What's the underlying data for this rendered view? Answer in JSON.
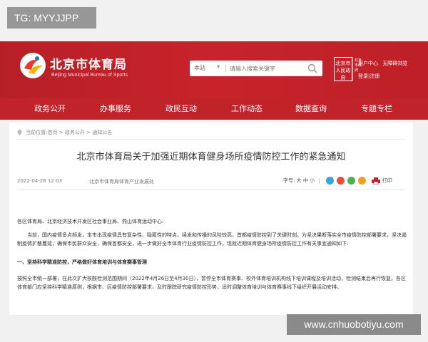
{
  "watermarks": {
    "top": "TG: MYYJJPP",
    "bottom": "www.cnhuobotiyu.com"
  },
  "header": {
    "site_title": "北京市体育局",
    "site_subtitle": "Beijing Municipal Bureau of Sports",
    "search": {
      "scope": "本站",
      "placeholder": "请输入搜索关键字"
    },
    "emblem_text": "北京市人民政府",
    "emblem2_text": "北京市政府",
    "links": [
      "用户中心",
      "无障碍浏览"
    ],
    "login": "登录|注册"
  },
  "nav": [
    "政务公开",
    "办事服务",
    "政民互动",
    "工作动态",
    "数据查询",
    "专题专栏"
  ],
  "breadcrumb": [
    "当前位置:首页",
    "政务公开",
    "通知公告"
  ],
  "article": {
    "title": "北京市体育局关于加强近期体育健身场所疫情防控工作的紧急通知",
    "date": "2022-04-26 12:03",
    "source": "北京市体育局体育产业发展处",
    "font_label": "字号:",
    "font_sizes": [
      "大",
      "中",
      "小"
    ],
    "print": "打印",
    "paragraphs": [
      "各区体育局、北京经济技术开发区社会事业局、燕山体育运动中心:",
      "当前，国内疫情多点频发，本市出现疫情具有复杂性、隐匿性的特点，续发和传播的风险较高，首都疫情防控到了关键时刻。为坚决果断落实全市疫情防控部署要求，坚决遏制疫情扩散蔓延，确保市民群众安全，确保首都安全，进一步做好全市体育行业疫情防控工作，现就近期体育健身场所疫情防控工作有关事宜通知如下:",
      "一、坚持科学精准防控，严格做好体育培训与体育赛事管理",
      "按照全市统一部署，在此次扩大核酸检测范围期间（2022年4月26日至4月30日），暂停全市体育赛事、校外体育培训机构线下培训课程及培训活动，检测结束后再行恢复。各区体育部门应坚持科学精准原则，根据市、区疫情防控部署要求，及时跟踪研究疫情防控形势，适时调整体育培训与体育赛事线下组织开展活动安排。"
    ]
  },
  "colors": {
    "brand_red": "#c0232a",
    "share_colors": [
      "#3aa5dc",
      "#e2513b",
      "#4caf50",
      "#f0a020"
    ]
  }
}
